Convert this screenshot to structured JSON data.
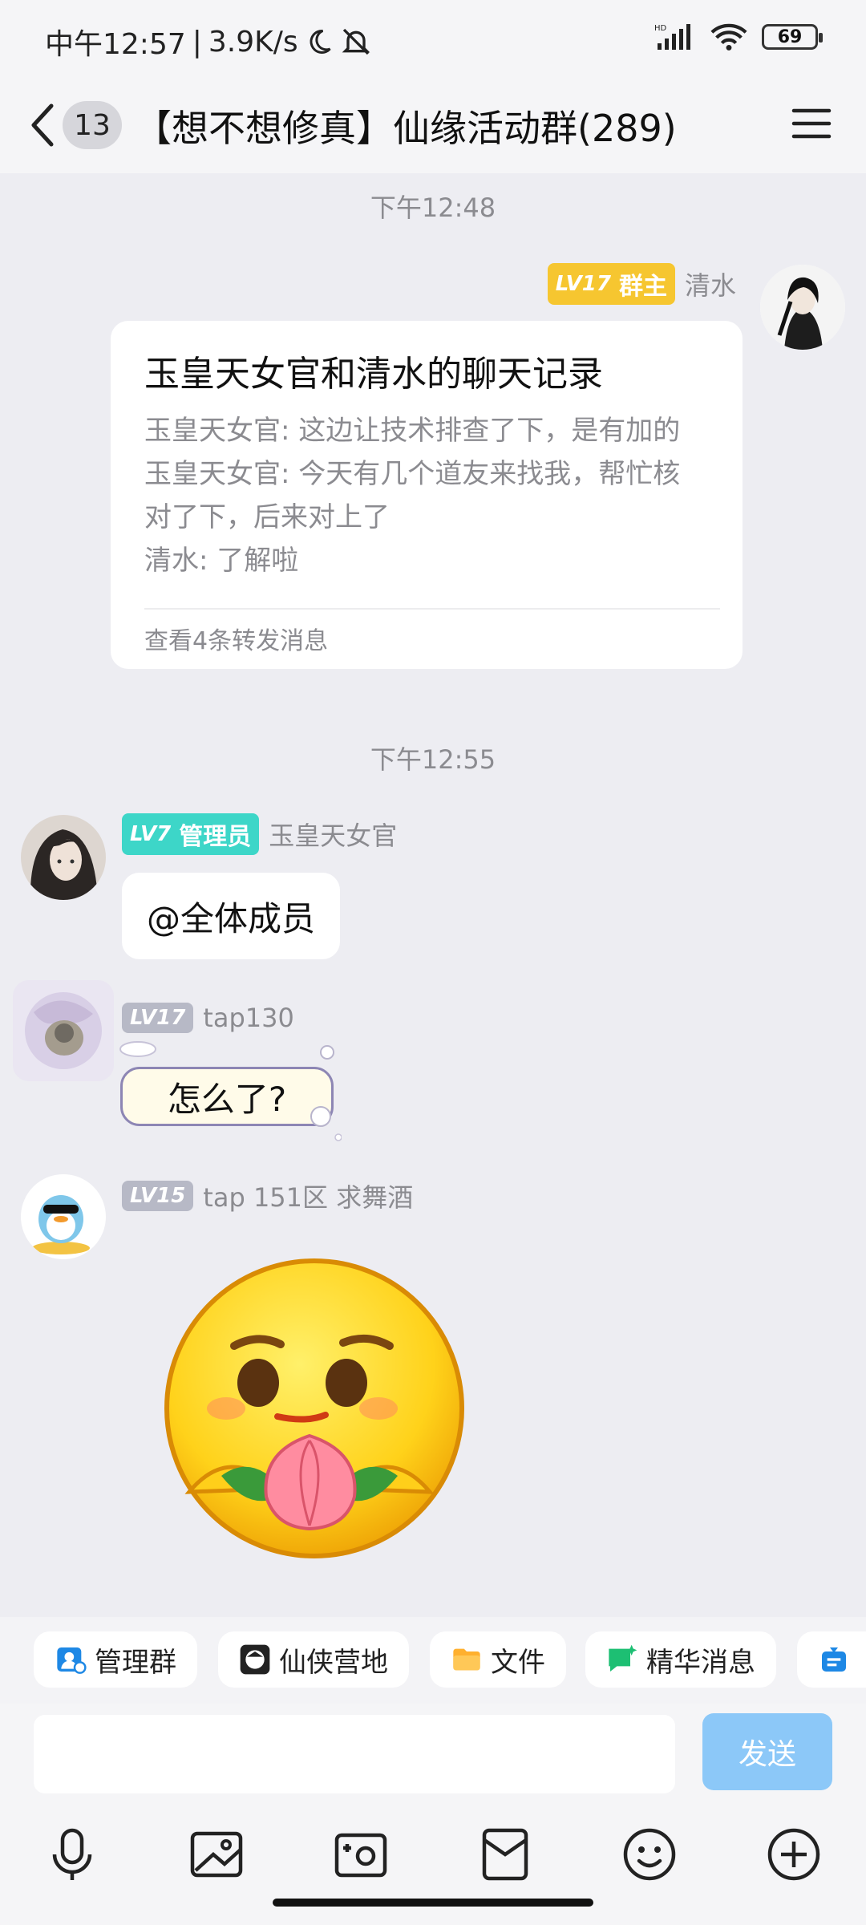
{
  "status_bar": {
    "time": "中午12:57",
    "speed": "3.9K/s",
    "separator": "|",
    "network": "HD",
    "battery": "69"
  },
  "header": {
    "unread_count": "13",
    "title": "【想不想修真】仙缘活动群(289)"
  },
  "messages": {
    "time1": "下午12:48",
    "msg1": {
      "level": "LV17",
      "role": "群主",
      "sender": "清水",
      "card_title": "玉皇天女官和清水的聊天记录",
      "lines": [
        "玉皇天女官: 这边让技术排查了下，是有加的",
        "玉皇天女官: 今天有几个道友来找我，帮忙核",
        "对了下，后来对上了",
        "清水: 了解啦"
      ],
      "footer": "查看4条转发消息"
    },
    "time2": "下午12:55",
    "msg2": {
      "level": "LV7",
      "role": "管理员",
      "sender": "玉皇天女官",
      "text": "@全体成员"
    },
    "msg3": {
      "level": "LV17",
      "sender": "tap130",
      "text": "怎么了?"
    },
    "msg4": {
      "level": "LV15",
      "sender": "tap 151区 求舞酒",
      "sticker": "peach-holding-emoji-sticker"
    }
  },
  "quick_actions": [
    {
      "label": "管理群",
      "icon": "manage-group-icon"
    },
    {
      "label": "仙侠营地",
      "icon": "xianxia-camp-icon"
    },
    {
      "label": "文件",
      "icon": "folder-icon"
    },
    {
      "label": "精华消息",
      "icon": "essence-message-icon"
    }
  ],
  "composer": {
    "send_label": "发送",
    "placeholder": ""
  },
  "colors": {
    "accent_send_disabled": "#8cc8f8",
    "owner_badge": "#f6c630",
    "admin_badge": "#3dd6c8",
    "member_badge": "#b7b9c6"
  }
}
